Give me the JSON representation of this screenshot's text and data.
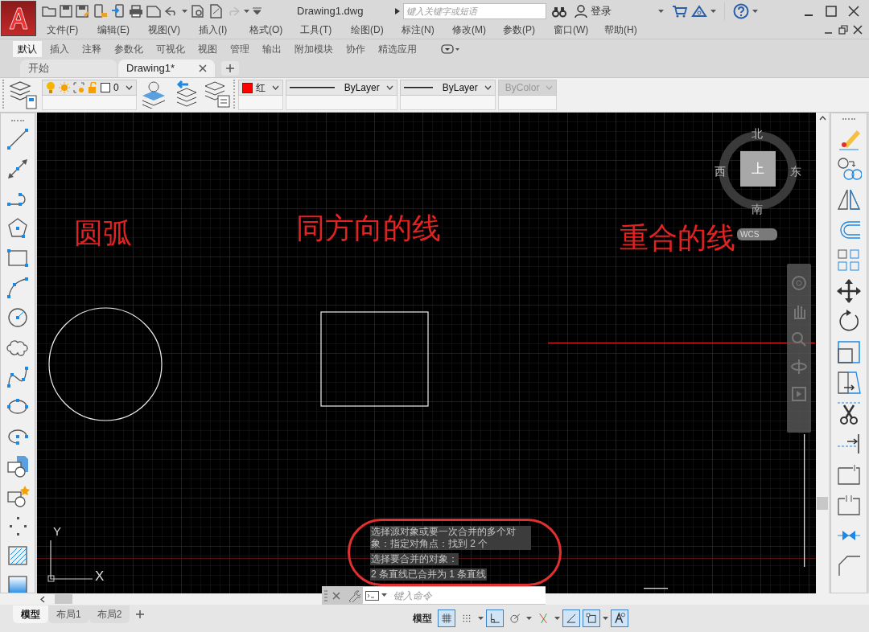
{
  "title_bar": {
    "title": "Drawing1.dwg",
    "search": {
      "placeholder": "键入关键字或短语"
    },
    "login": "登录"
  },
  "menu": [
    "文件(F)",
    "编辑(E)",
    "视图(V)",
    "插入(I)",
    "格式(O)",
    "工具(T)",
    "绘图(D)",
    "标注(N)",
    "修改(M)",
    "参数(P)",
    "窗口(W)",
    "帮助(H)"
  ],
  "ribbon_tabs": [
    {
      "label": "默认",
      "selected": true
    },
    {
      "label": "插入",
      "selected": false
    },
    {
      "label": "注释",
      "selected": false
    },
    {
      "label": "参数化",
      "selected": false
    },
    {
      "label": "可视化",
      "selected": false
    },
    {
      "label": "视图",
      "selected": false
    },
    {
      "label": "管理",
      "selected": false
    },
    {
      "label": "输出",
      "selected": false
    },
    {
      "label": "附加模块",
      "selected": false
    },
    {
      "label": "协作",
      "selected": false
    },
    {
      "label": "精选应用",
      "selected": false
    }
  ],
  "file_tabs": [
    {
      "label": "开始",
      "selected": false
    },
    {
      "label": "Drawing1*",
      "selected": true
    }
  ],
  "properties_toolbar": {
    "layer": "0",
    "color_name": "红",
    "linetype": "ByLayer",
    "lineweight": "ByLayer",
    "plot_style": {
      "label": "ByColor",
      "disabled": true
    }
  },
  "canvas": {
    "annotations": [
      "圆弧",
      "同方向的线",
      "重合的线"
    ],
    "ucs_axes": {
      "y": "Y",
      "x": "X"
    },
    "viewcube": {
      "north": "北",
      "south": "南",
      "west": "西",
      "east": "东",
      "face": "上",
      "ucs": "WCS"
    },
    "command_history": [
      "选择源对象或要一次合并的多个对象：指定对角点：找到 2 个",
      "选择要合并的对象：",
      "2 条直线已合并为 1 条直线"
    ]
  },
  "command_line": {
    "placeholder": "键入命令"
  },
  "layout_tabs": [
    {
      "label": "模型",
      "selected": true
    },
    {
      "label": "布局1",
      "selected": false
    },
    {
      "label": "布局2",
      "selected": false
    }
  ],
  "status_bar": {
    "space": "模型",
    "toggles": [
      {
        "kind": "grid",
        "on": true
      },
      {
        "kind": "snap",
        "on": false
      },
      {
        "kind": "ortho",
        "on": true
      },
      {
        "kind": "polar",
        "on": false
      },
      {
        "kind": "isodraft",
        "on": false
      },
      {
        "kind": "tracking",
        "on": true
      },
      {
        "kind": "osnap",
        "on": true
      },
      {
        "kind": "annotation",
        "on": true
      }
    ]
  }
}
